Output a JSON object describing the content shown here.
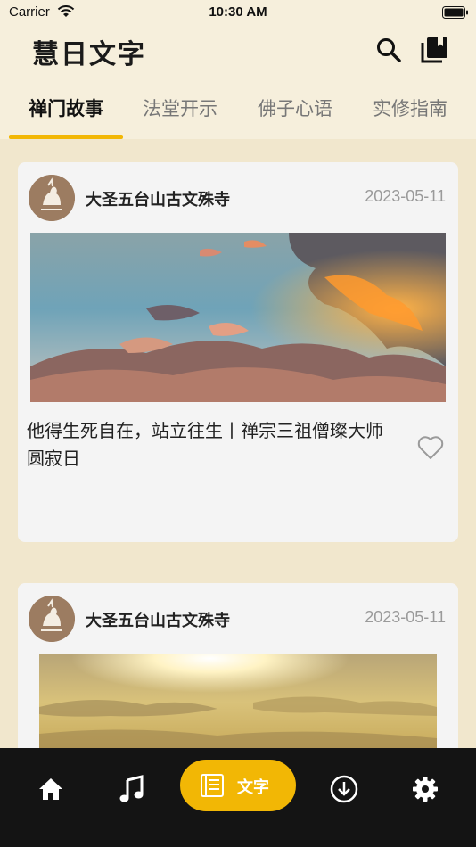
{
  "status": {
    "carrier": "Carrier",
    "time": "10:30 AM"
  },
  "header": {
    "title": "慧日文字",
    "icons": [
      "search-icon",
      "book-collection-icon"
    ]
  },
  "tabs": [
    {
      "label": "禅门故事",
      "active": true
    },
    {
      "label": "法堂开示",
      "active": false
    },
    {
      "label": "佛子心语",
      "active": false
    },
    {
      "label": "实修指南",
      "active": false
    }
  ],
  "cards": [
    {
      "publisher": "大圣五台山古文殊寺",
      "date": "2023-05-11",
      "title": "他得生死自在，站立往生丨禅宗三祖僧璨大师圆寂日",
      "favorite": false
    },
    {
      "publisher": "大圣五台山古文殊寺",
      "date": "2023-05-11"
    }
  ],
  "tabbar": {
    "items": [
      "home-icon",
      "music-note-icon",
      "document-icon",
      "download-icon",
      "settings-gear-icon"
    ],
    "active_label": "文字",
    "active_color": "#f2b705"
  }
}
